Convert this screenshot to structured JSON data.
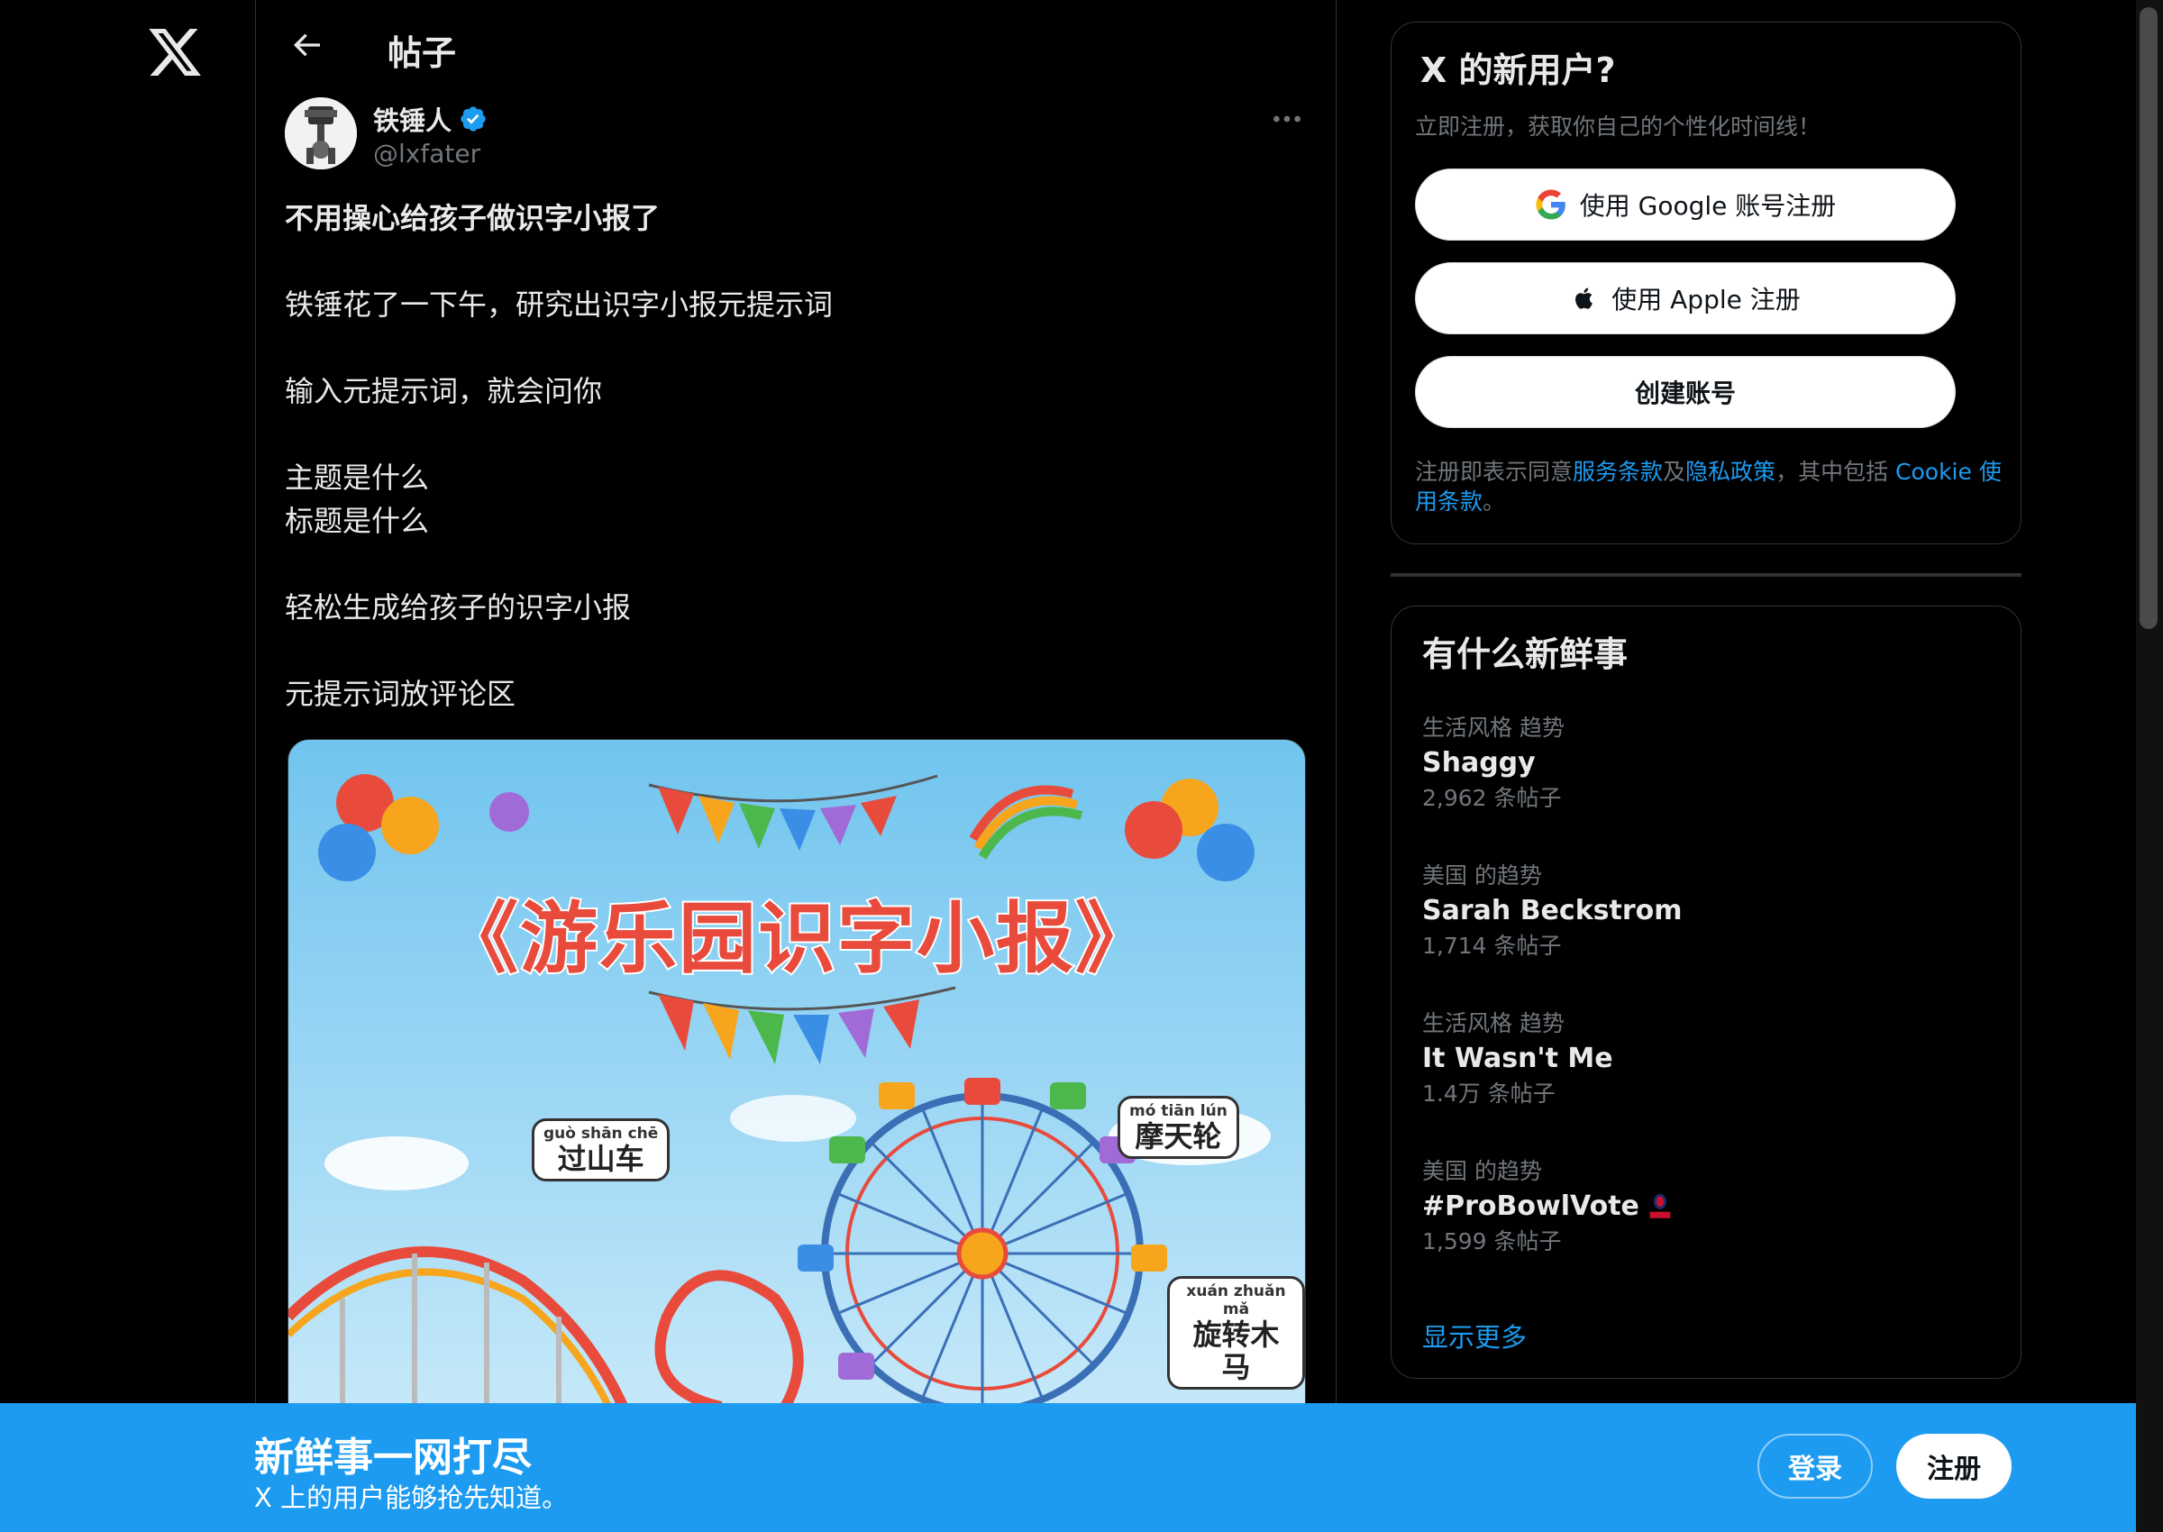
{
  "header": {
    "title": "帖子"
  },
  "post": {
    "author_name": "铁锤人",
    "author_handle": "@lxfater",
    "lines": [
      "不用操心给孩子做识字小报了",
      "",
      "铁锤花了一下午，研究出识字小报元提示词",
      "",
      "输入元提示词，就会问你",
      "",
      "主题是什么",
      "标题是什么",
      "",
      "轻松生成给孩子的识字小报",
      "",
      "元提示词放评论区"
    ],
    "image": {
      "title": "《游乐园识字小报》",
      "labels": [
        {
          "pinyin": "guò shān chē",
          "hanzi": "过山车"
        },
        {
          "pinyin": "mó tiān lún",
          "hanzi": "摩天轮"
        },
        {
          "pinyin": "xuán zhuǎn mǎ",
          "hanzi": "旋转木马"
        }
      ]
    }
  },
  "signup": {
    "title": "X 的新用户?",
    "subtitle": "立即注册，获取你自己的个性化时间线！",
    "google_label": "使用 Google 账号注册",
    "apple_label": "使用 Apple 注册",
    "create_label": "创建账号",
    "terms_prefix": "注册即表示同意",
    "terms_link": "服务条款",
    "terms_and": "及",
    "privacy_link": "隐私政策",
    "terms_mid": "，其中包括 ",
    "cookie_link": "Cookie 使用条款",
    "terms_end": "。"
  },
  "trends": {
    "title": "有什么新鲜事",
    "items": [
      {
        "category": "生活风格 趋势",
        "name": "Shaggy",
        "count": "2,962 条帖子"
      },
      {
        "category": "美国 的趋势",
        "name": "Sarah Beckstrom",
        "count": "1,714 条帖子"
      },
      {
        "category": "生活风格 趋势",
        "name": "It Wasn't Me",
        "count": "1.4万 条帖子"
      },
      {
        "category": "美国 的趋势",
        "name": "#ProBowlVote",
        "count": "1,599 条帖子"
      }
    ],
    "show_more": "显示更多"
  },
  "banner": {
    "title": "新鲜事一网打尽",
    "subtitle": "X 上的用户能够抢先知道。",
    "login": "登录",
    "register": "注册"
  },
  "colors": {
    "accent": "#1d9bf0",
    "background": "#000000",
    "muted": "#71767b"
  }
}
